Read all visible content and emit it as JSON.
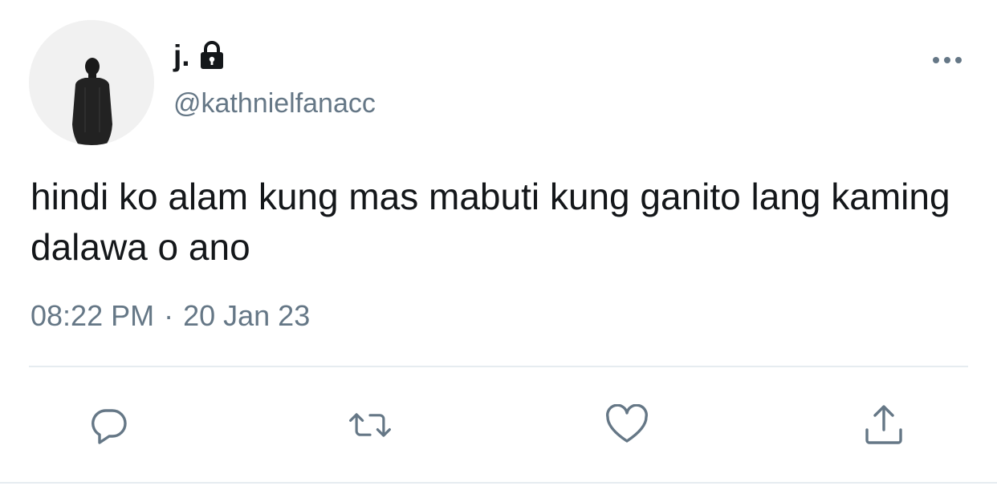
{
  "tweet": {
    "author": {
      "display_name": "j.",
      "handle": "@kathnielfanacc",
      "protected_icon": "lock-icon",
      "avatar_icon": "avatar-silhouette"
    },
    "text": "hindi ko alam kung mas mabuti kung ganito lang kaming dalawa o ano",
    "time": "08:22 PM",
    "separator": "·",
    "date": "20 Jan 23",
    "more_icon": "more-options-icon"
  },
  "actions": [
    {
      "name": "reply",
      "icon": "reply-icon"
    },
    {
      "name": "retweet",
      "icon": "retweet-icon"
    },
    {
      "name": "like",
      "icon": "heart-icon"
    },
    {
      "name": "share",
      "icon": "share-icon"
    }
  ],
  "colors": {
    "primary_text": "#14171a",
    "secondary_text": "#657786",
    "icon": "#657786",
    "divider": "#e6ecf0",
    "background": "#ffffff"
  }
}
